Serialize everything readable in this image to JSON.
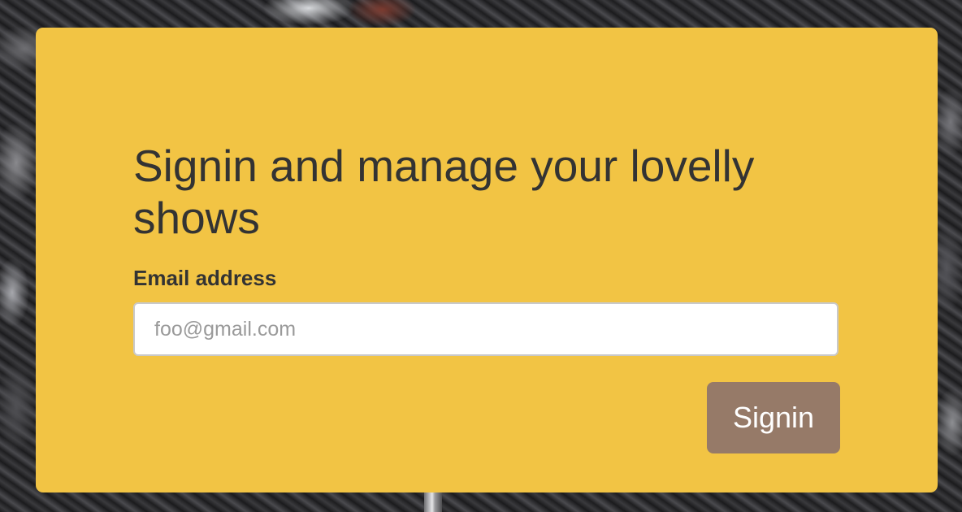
{
  "signin": {
    "heading": "Signin and manage your lovelly shows",
    "email_label": "Email address",
    "email_value": "",
    "email_placeholder": "foo@gmail.com",
    "submit_label": "Signin"
  },
  "colors": {
    "card_background": "#f2c444",
    "button_background": "#967a68",
    "text_primary": "#333333"
  }
}
